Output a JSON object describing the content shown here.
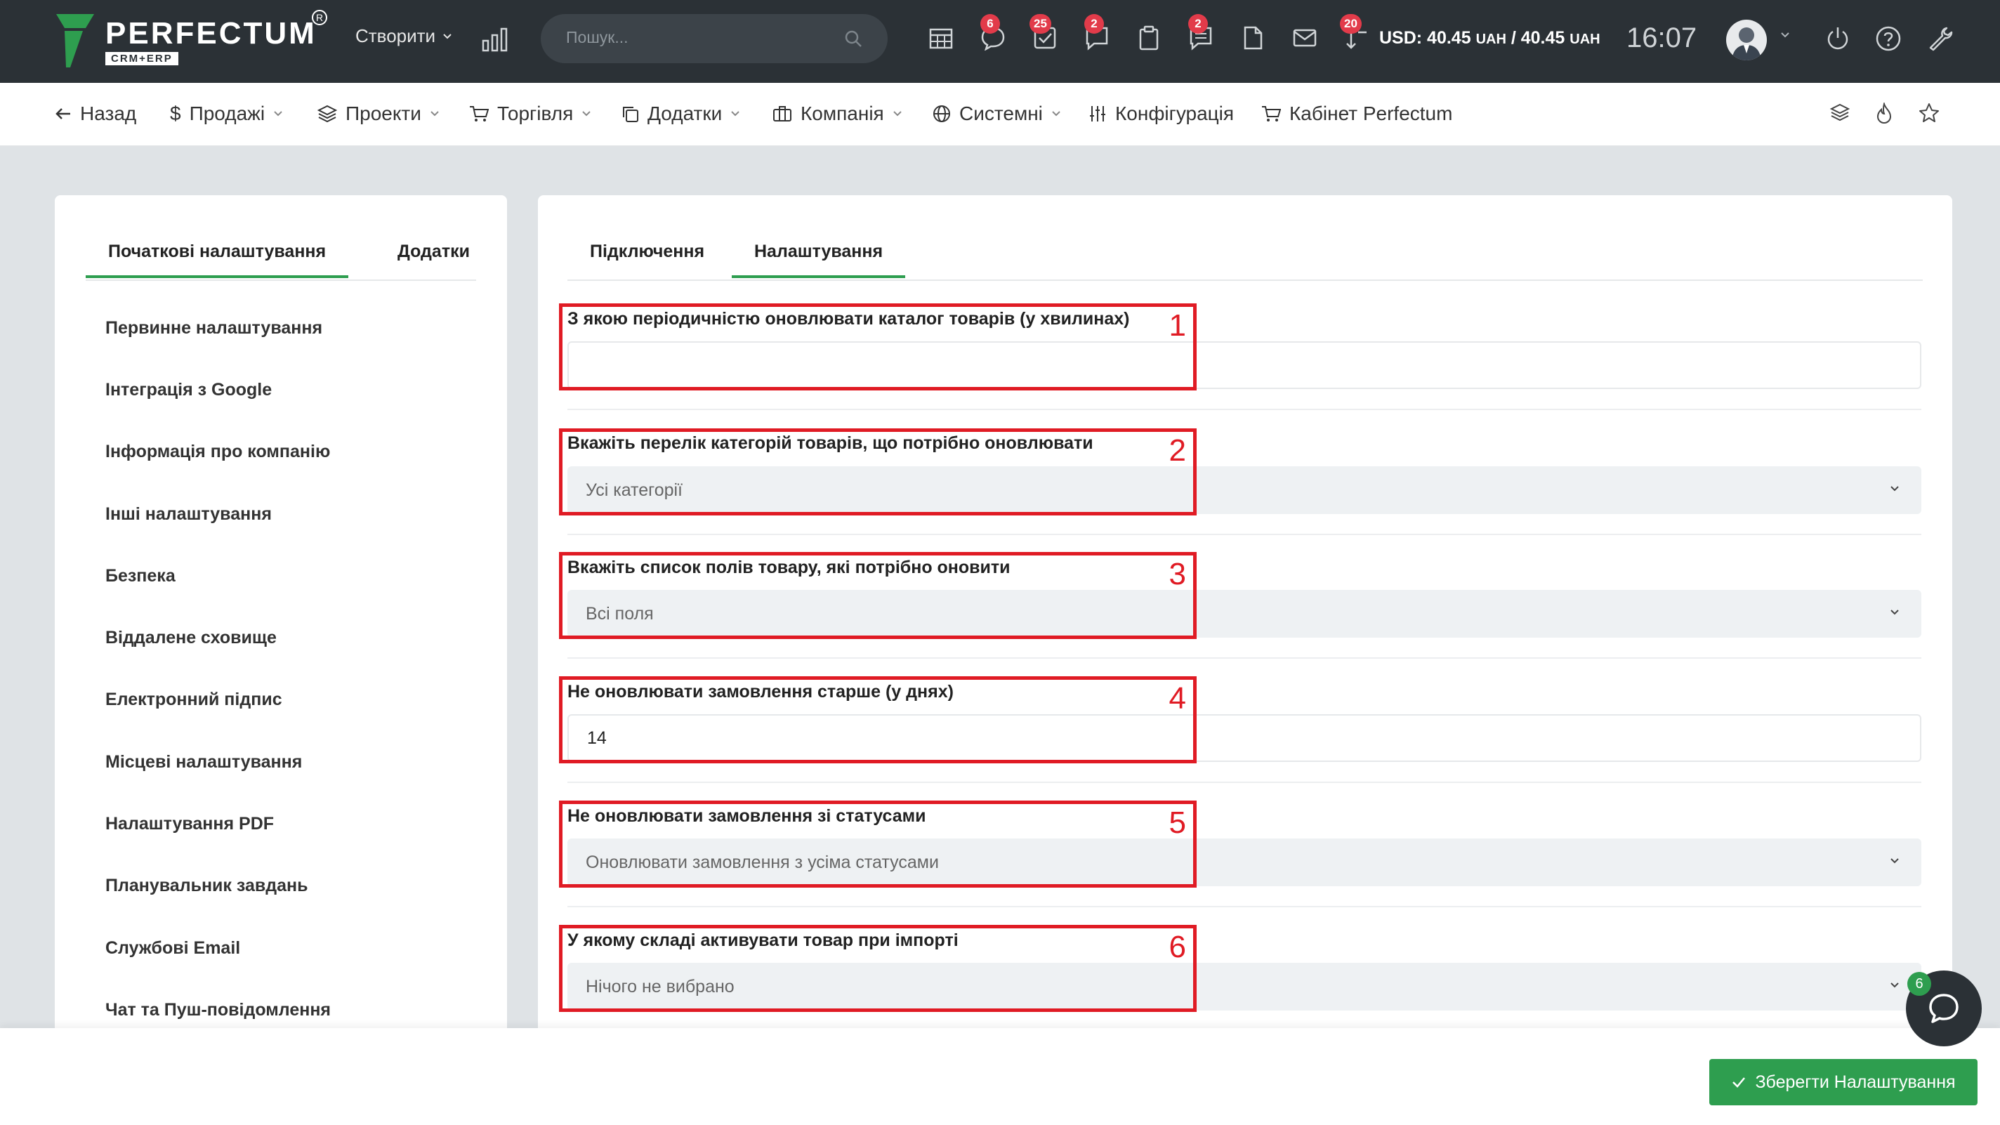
{
  "topbar": {
    "logo_name": "PERFECTUM",
    "logo_sub": "CRM+ERP",
    "create_label": "Створити",
    "search_placeholder": "Пошук...",
    "badges": {
      "chat": "6",
      "tasks": "25",
      "messages": "2",
      "notes": "2",
      "reminders": "20"
    },
    "currency_prefix": "USD: 40.45 ",
    "currency_unit1": "UAH",
    "currency_mid": " / 40.45 ",
    "currency_unit2": "UAH",
    "time": "16:07",
    "icons": [
      "chart-icon",
      "calendar-icon",
      "chat-icon",
      "tasks-icon",
      "messages-icon",
      "clipboard-icon",
      "notes-icon",
      "document-icon",
      "mail-icon",
      "reminder-icon",
      "power-icon",
      "help-icon",
      "wrench-icon"
    ]
  },
  "nav": {
    "back": "Назад",
    "sales": "Продажі",
    "projects": "Проекти",
    "trade": "Торгівля",
    "addons": "Додатки",
    "company": "Компанія",
    "system": "Системні",
    "config": "Конфігурація",
    "cabinet": "Кабінет Perfectum"
  },
  "left_panel": {
    "tabs": [
      "Початкові налаштування",
      "Додатки"
    ],
    "items": [
      "Первинне налаштування",
      "Інтеграція з Google",
      "Інформація про компанію",
      "Інші налаштування",
      "Безпека",
      "Віддалене сховище",
      "Електронний підпис",
      "Місцеві налаштування",
      "Налаштування PDF",
      "Планувальник завдань",
      "Службові Email",
      "Чат та Пуш-повідомлення"
    ]
  },
  "right_panel": {
    "tabs": [
      "Підключення",
      "Налаштування"
    ],
    "fields": [
      {
        "label": "З якою періодичністю оновлювати каталог товарів (у хвилинах)",
        "value": "",
        "type": "input",
        "num": "1"
      },
      {
        "label": "Вкажіть перелік категорій товарів, що потрібно оновлювати",
        "value": "Усі категорії",
        "type": "select",
        "num": "2"
      },
      {
        "label": "Вкажіть список полів товару, які потрібно оновити",
        "value": "Всі поля",
        "type": "select",
        "num": "3"
      },
      {
        "label": "Не оновлювати замовлення старше (у днях)",
        "value": "14",
        "type": "input",
        "num": "4"
      },
      {
        "label": "Не оновлювати замовлення зі статусами",
        "value": "Оновлювати замовлення з усіма статусами",
        "type": "select",
        "num": "5"
      },
      {
        "label": "У якому складі активувати товар при імпорті",
        "value": "Нічого не вибрано",
        "type": "select",
        "num": "6"
      }
    ]
  },
  "footer": {
    "save_label": "Зберегти Налаштування",
    "chat_badge": "6"
  },
  "colors": {
    "accent": "#2e9e4f",
    "topbar": "#2b3136",
    "badge": "#e23b4a",
    "highlight": "#e01b24"
  }
}
